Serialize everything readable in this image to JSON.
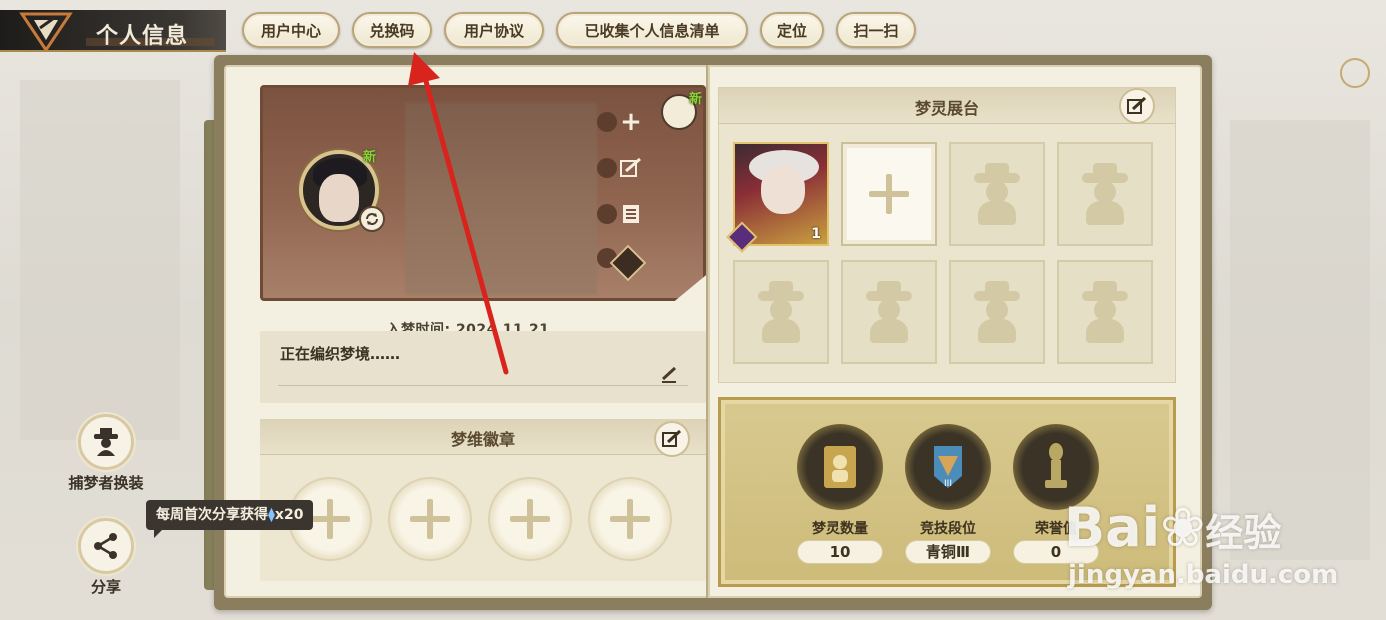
{
  "header": {
    "title": "个人信息",
    "tabs": [
      "用户中心",
      "兑换码",
      "用户协议",
      "已收集个人信息清单",
      "定位",
      "扫一扫"
    ]
  },
  "profile": {
    "new_badge": "新",
    "join_date": "入梦时间: 2024.11.21",
    "signature": "正在编织梦境……"
  },
  "badges": {
    "title": "梦维徽章"
  },
  "display": {
    "title": "梦灵展台",
    "char_level": "1"
  },
  "stats": [
    {
      "label": "梦灵数量",
      "value": "10"
    },
    {
      "label": "竞技段位",
      "value": "青铜Ⅲ"
    },
    {
      "label": "荣誉值",
      "value": "0"
    }
  ],
  "side": {
    "outfit_label": "捕梦者换装",
    "share_label": "分享",
    "tooltip": "每周首次分享获得",
    "tooltip_reward": "x20"
  },
  "watermark": {
    "brand": "Bai",
    "brand_cn": "经验",
    "url": "jingyan.baidu.com"
  }
}
